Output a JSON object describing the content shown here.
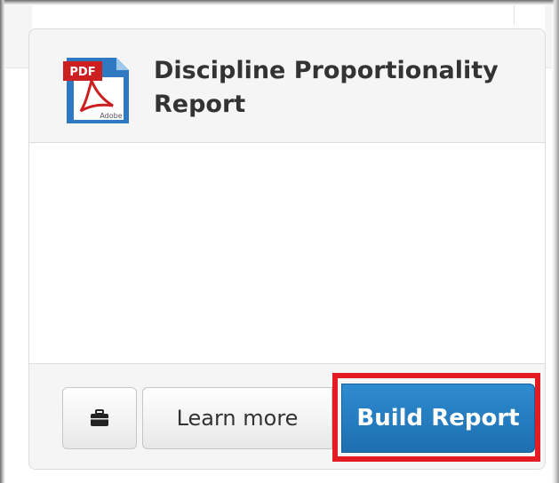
{
  "card": {
    "title": "Discipline Proportionality Report",
    "icon": "pdf-adobe-icon",
    "icon_badge_text": "PDF",
    "icon_brand_text": "Adobe"
  },
  "footer": {
    "icon_button_icon": "briefcase-icon",
    "learn_more_label": "Learn more",
    "build_report_label": "Build Report"
  },
  "colors": {
    "accent_blue": "#2079bf",
    "highlight_red": "#e31b23",
    "pdf_badge_red": "#cc1f1f",
    "icon_blue": "#2f79c2"
  }
}
